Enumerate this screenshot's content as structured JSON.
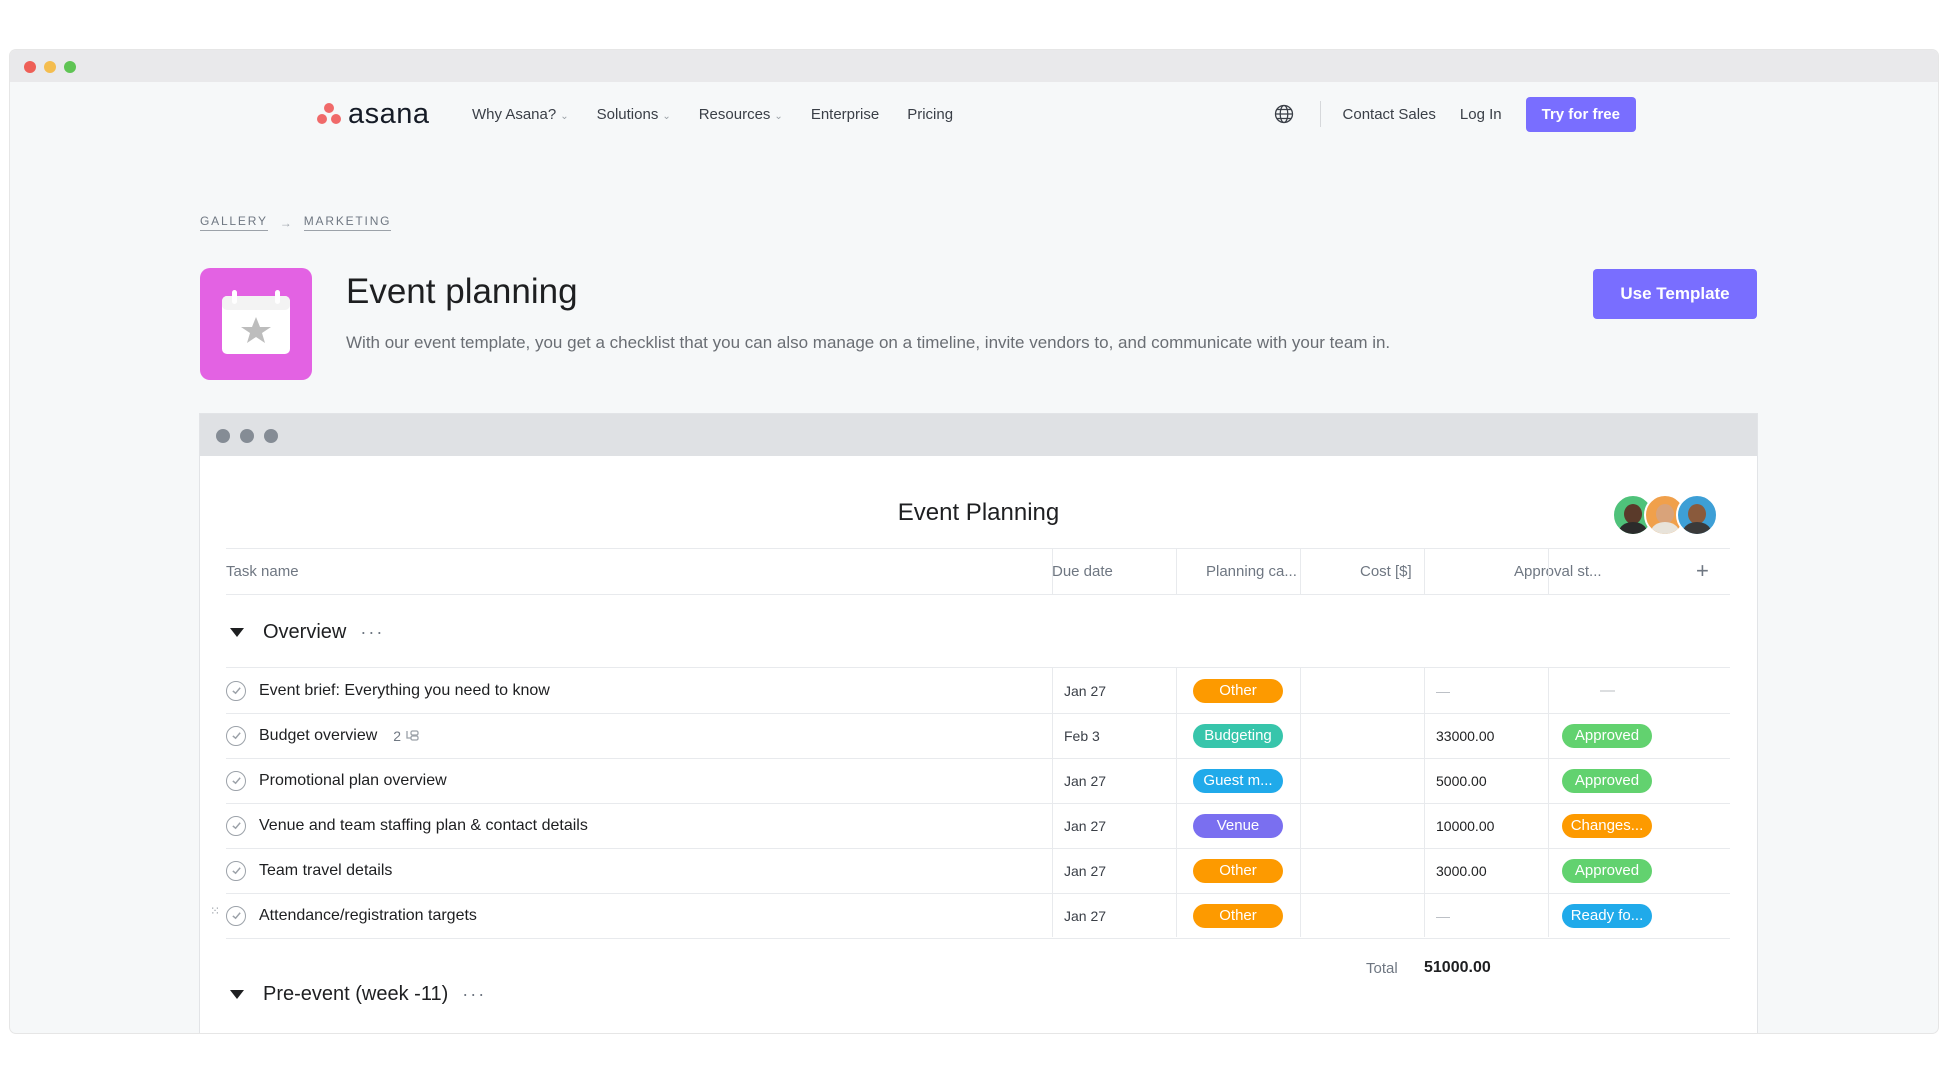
{
  "nav": {
    "logo_text": "asana",
    "links": [
      {
        "label": "Why Asana?",
        "has_caret": true
      },
      {
        "label": "Solutions",
        "has_caret": true
      },
      {
        "label": "Resources",
        "has_caret": true
      },
      {
        "label": "Enterprise",
        "has_caret": false
      },
      {
        "label": "Pricing",
        "has_caret": false
      }
    ],
    "contact_sales": "Contact Sales",
    "log_in": "Log In",
    "try_free": "Try for free"
  },
  "breadcrumb": {
    "gallery": "GALLERY",
    "marketing": "MARKETING"
  },
  "header": {
    "title": "Event planning",
    "description": "With our event template, you get a checklist that you can also manage on a timeline, invite vendors to, and communicate with your team in.",
    "use_template": "Use Template"
  },
  "project": {
    "title": "Event Planning",
    "columns": {
      "task_name": "Task name",
      "due_date": "Due date",
      "planning": "Planning ca...",
      "cost": "Cost [$]",
      "approval": "Approval st...",
      "add": "+"
    },
    "sections": [
      {
        "name": "Overview",
        "more": "···",
        "tasks": [
          {
            "name": "Event brief: Everything you need to know",
            "subtasks": "",
            "due": "Jan 27",
            "category": "Other",
            "category_color": "#fd9a00",
            "cost": "—",
            "approval": "—",
            "approval_color": ""
          },
          {
            "name": "Budget overview",
            "subtasks": "2",
            "due": "Feb 3",
            "category": "Budgeting",
            "category_color": "#37c5ab",
            "cost": "33000.00",
            "approval": "Approved",
            "approval_color": "#62d26f"
          },
          {
            "name": "Promotional plan overview",
            "subtasks": "",
            "due": "Jan 27",
            "category": "Guest m...",
            "category_color": "#20aaea",
            "cost": "5000.00",
            "approval": "Approved",
            "approval_color": "#62d26f"
          },
          {
            "name": "Venue and team staffing plan & contact details",
            "subtasks": "",
            "due": "Jan 27",
            "category": "Venue",
            "category_color": "#7a6ff0",
            "cost": "10000.00",
            "approval": "Changes...",
            "approval_color": "#fd9a00"
          },
          {
            "name": "Team travel details",
            "subtasks": "",
            "due": "Jan 27",
            "category": "Other",
            "category_color": "#fd9a00",
            "cost": "3000.00",
            "approval": "Approved",
            "approval_color": "#62d26f"
          },
          {
            "name": "Attendance/registration targets",
            "subtasks": "",
            "due": "Jan 27",
            "category": "Other",
            "category_color": "#fd9a00",
            "cost": "—",
            "approval": "Ready fo...",
            "approval_color": "#20aaea"
          }
        ],
        "total_label": "Total",
        "total_value": "51000.00"
      },
      {
        "name": "Pre-event (week -11)",
        "more": "···",
        "tasks": []
      }
    ]
  },
  "colors": {
    "accent": "#796eff",
    "template_icon": "#e362e3",
    "logo": "#f06a6a"
  },
  "icons": [
    "globe-icon",
    "calendar-star-icon",
    "check-circle-icon",
    "subtask-icon",
    "triangle-down-icon",
    "more-icon",
    "drag-handle-icon",
    "plus-icon"
  ]
}
